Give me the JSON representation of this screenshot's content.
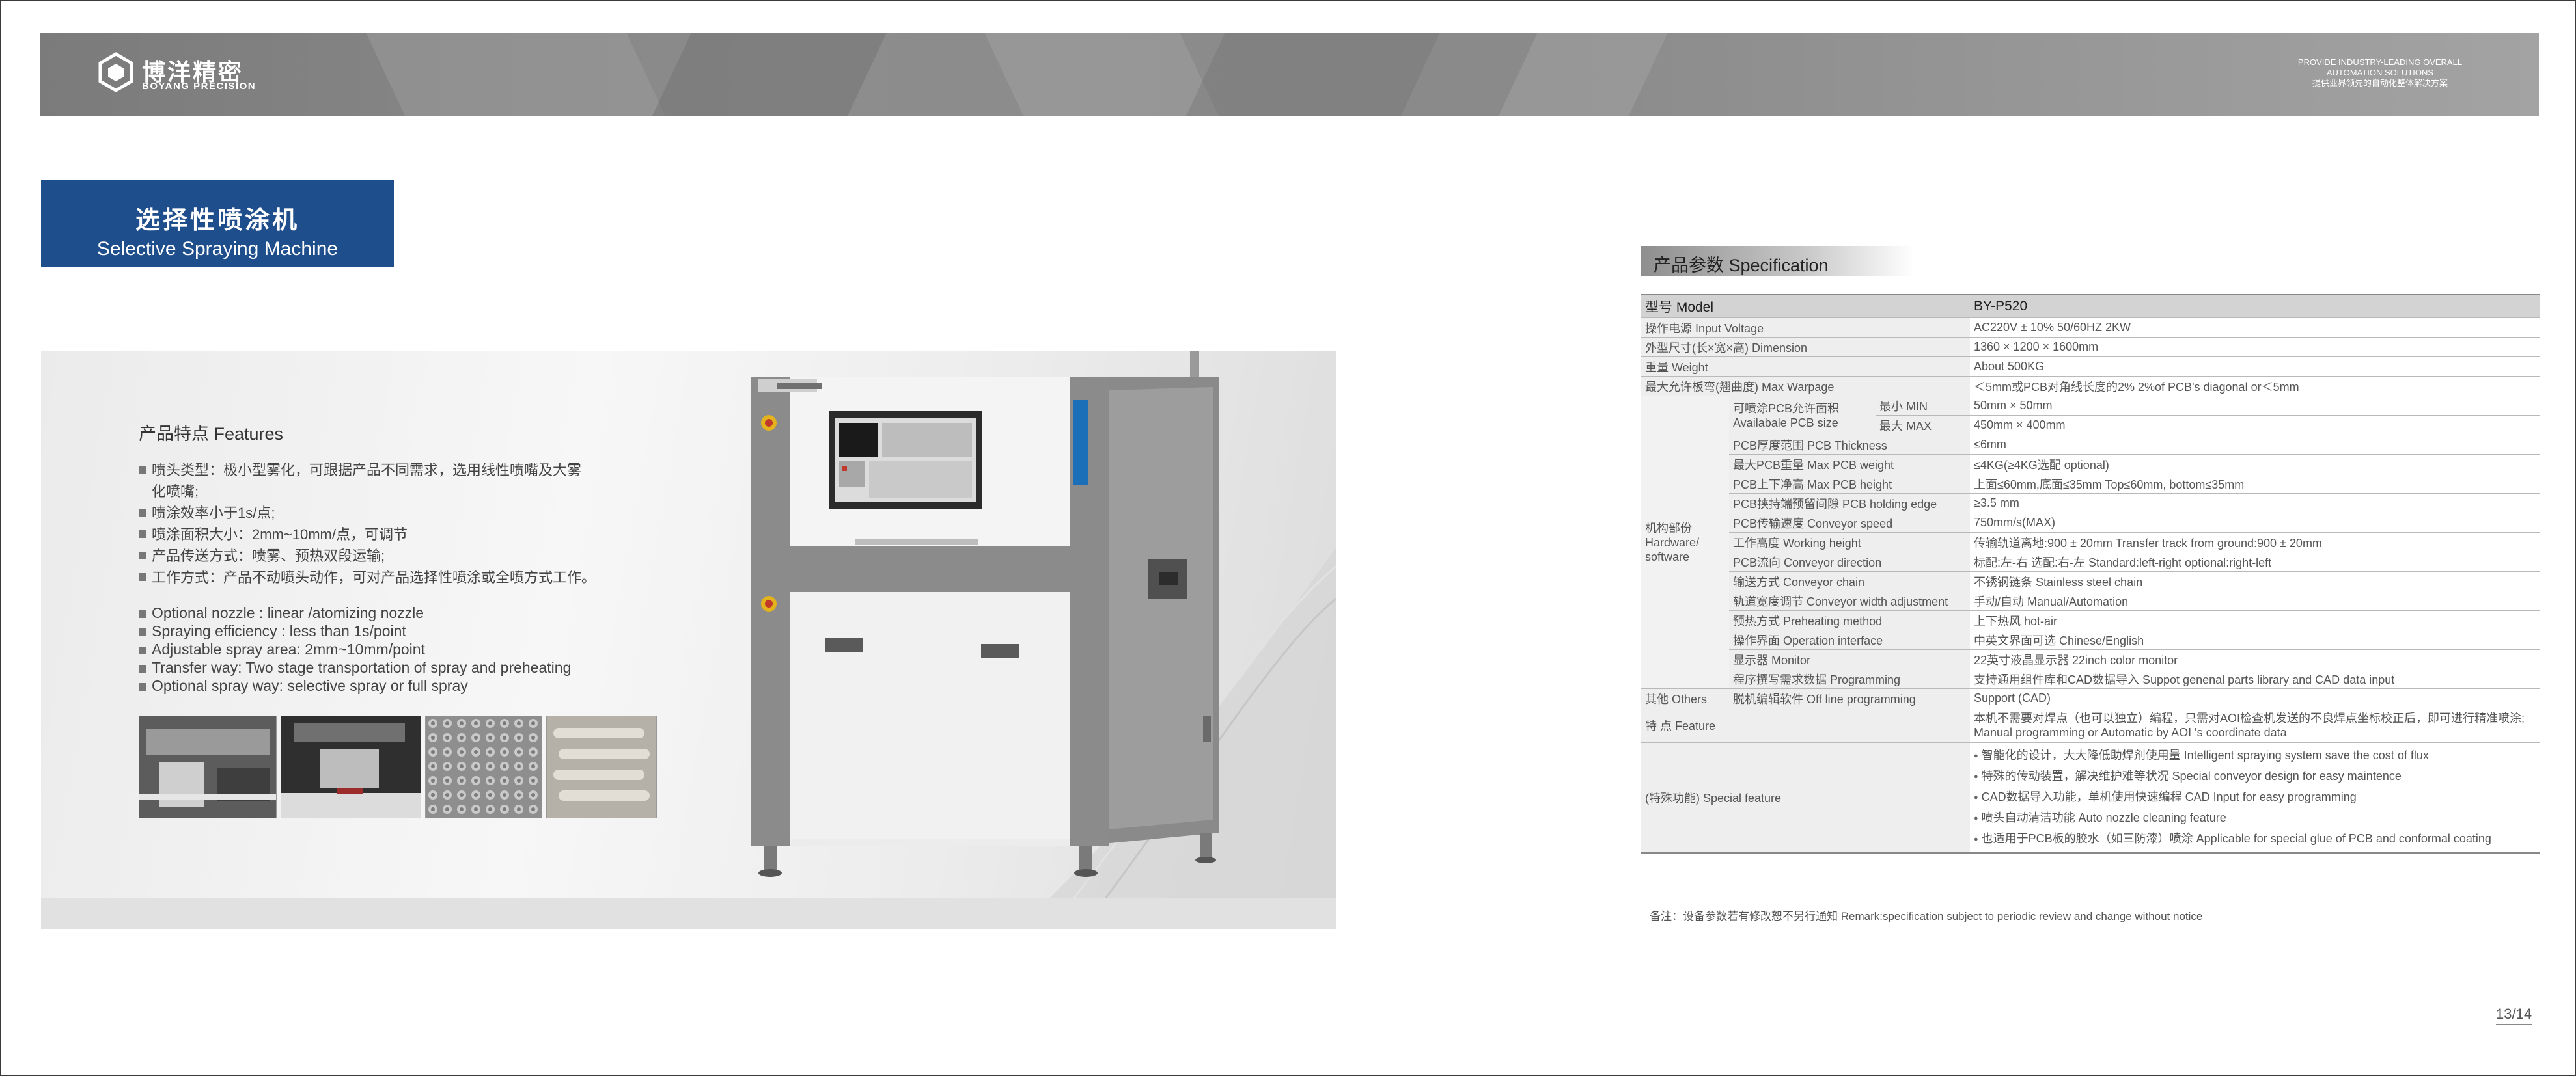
{
  "brand": {
    "name_cn": "博洋精密",
    "name_en": "BOYANG PRECISION",
    "tagline_en_1": "PROVIDE INDUSTRY-LEADING OVERALL",
    "tagline_en_2": "AUTOMATION SOLUTIONS",
    "tagline_cn": "提供业界领先的自动化整体解决方案"
  },
  "title": {
    "cn": "选择性喷涂机",
    "en": "Selective Spraying Machine"
  },
  "features": {
    "heading": "产品特点 Features",
    "cn": [
      {
        "text": "喷头类型：极小型雾化，可跟据产品不同需求，选用线性喷嘴及大雾",
        "bullet": true
      },
      {
        "text": "化喷嘴;",
        "bullet": false
      },
      {
        "text": "喷涂效率小于1s/点;",
        "bullet": true
      },
      {
        "text": "喷涂面积大小：2mm~10mm/点，可调节",
        "bullet": true
      },
      {
        "text": "产品传送方式：喷雾、预热双段运输;",
        "bullet": true
      },
      {
        "text": "工作方式：产品不动喷头动作，可对产品选择性喷涂或全喷方式工作。",
        "bullet": true
      }
    ],
    "en": [
      "Optional nozzle : linear /atomizing nozzle",
      "Spraying efficiency : less than 1s/point",
      "Adjustable spray area: 2mm~10mm/point",
      "Transfer way: Two stage transportation of spray and preheating",
      "Optional spray way: selective spray or full spray"
    ]
  },
  "spec": {
    "heading": "产品参数 Specification",
    "model_label": "型号 Model",
    "model_value": "BY-P520",
    "rows_top": [
      {
        "label": "操作电源 Input Voltage",
        "value": "AC220V ± 10% 50/60HZ 2KW"
      },
      {
        "label": "外型尺寸(长×宽×高) Dimension",
        "value": "1360 × 1200 × 1600mm"
      },
      {
        "label": "重量 Weight",
        "value": "About 500KG"
      },
      {
        "label": "最大允许板弯(翘曲度) Max Warpage",
        "value": "＜5mm或PCB对角线长度的2%  2%of PCB's diagonal or＜5mm"
      }
    ],
    "hardware_group": "机构部份 Hardware/ software",
    "pcb_size_label": "可喷涂PCB允许面积 Availabale PCB size",
    "pcb_min_label": "最小 MIN",
    "pcb_min_value": "50mm × 50mm",
    "pcb_max_label": "最大 MAX",
    "pcb_max_value": "450mm × 400mm",
    "hw_rows": [
      {
        "label": "PCB厚度范围 PCB Thickness",
        "value": "≤6mm"
      },
      {
        "label": "最大PCB重量 Max PCB weight",
        "value": "≤4KG(≥4KG选配 optional)"
      },
      {
        "label": "PCB上下净高 Max PCB height",
        "value": "上面≤60mm,底面≤35mm Top≤60mm, bottom≤35mm"
      },
      {
        "label": "PCB挟持端预留间隙 PCB holding edge",
        "value": "≥3.5 mm"
      },
      {
        "label": "PCB传输速度 Conveyor speed",
        "value": "750mm/s(MAX)"
      },
      {
        "label": "工作高度 Working height",
        "value": "传输轨道离地:900 ± 20mm Transfer track from ground:900 ± 20mm"
      },
      {
        "label": "PCB流向 Conveyor  direction",
        "value": "标配:左-右  选配:右-左 Standard:left-right  optional:right-left"
      },
      {
        "label": "输送方式 Conveyor chain",
        "value": "不锈钢链条 Stainless steel chain"
      },
      {
        "label": "轨道宽度调节 Conveyor width adjustment",
        "value": "手动/自动 Manual/Automation"
      },
      {
        "label": "预热方式 Preheating method",
        "value": "上下热风  hot-air"
      },
      {
        "label": "操作界面 Operation interface",
        "value": "中英文界面可选 Chinese/English"
      },
      {
        "label": "显示器 Monitor",
        "value": "22英寸液晶显示器 22inch color monitor"
      },
      {
        "label": "程序撰写需求数据 Programming",
        "value": "支持通用组件库和CAD数据导入 Suppot genenal parts library and CAD data input"
      }
    ],
    "others_group": "其他 Others",
    "others_label": "脱机编辑软件 Off line programming",
    "others_value": "Support (CAD)",
    "feature_label": "特  点 Feature",
    "feature_value_1": "本机不需要对焊点（也可以独立）编程，只需对AOI检查机发送的不良焊点坐标校正后，即可进行精准喷涂;",
    "feature_value_2": "Manual programming or Automatic by AOI 's coordinate data",
    "special_label": "(特殊功能) Special feature",
    "special_items": [
      "智能化的设计，大大降低助焊剂使用量 Intelligent spraying system save the cost of  flux",
      "特殊的传动装置，解决维护难等状况 Special conveyor design for easy maintence",
      "CAD数据导入功能，单机使用快速编程 CAD Input for easy programming",
      "喷头自动清洁功能 Auto nozzle cleaning feature",
      "也适用于PCB板的胶水（如三防漆）喷涂 Applicable for special glue of PCB and conformal coating"
    ]
  },
  "remark": "备注：设备参数若有修改恕不另行通知 Remark:specification subject to  periodic review and change without notice",
  "page_number": "13/14",
  "colors": {
    "title_bg": "#1f4e8c",
    "header_bg": "#8a8a8a",
    "table_head_bg": "#d3d3d3"
  }
}
